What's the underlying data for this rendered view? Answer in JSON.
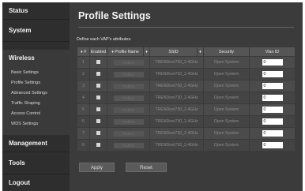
{
  "sidebar": {
    "items": [
      {
        "label": "Status"
      },
      {
        "label": "System"
      },
      {
        "label": "Wireless"
      },
      {
        "label": "Management"
      },
      {
        "label": "Tools"
      },
      {
        "label": "Logout"
      }
    ],
    "wireless_subitems": [
      {
        "label": "Basic Settings"
      },
      {
        "label": "Profile Settings"
      },
      {
        "label": "Advanced Settings"
      },
      {
        "label": "Traffic Shaping"
      },
      {
        "label": "Access Control"
      },
      {
        "label": "WDS Settings"
      }
    ]
  },
  "main": {
    "title": "Profile Settings",
    "description": "Define each VAP's attributes.",
    "table": {
      "headers": [
        "♦ #",
        "Enabled",
        "♦ Profile Name",
        "♦",
        "SSID",
        "♦",
        "Security",
        "Vlan ID"
      ],
      "rows": [
        {
          "num": "1",
          "profile": "Profile1",
          "ssid": "TRENDnet730_2.4GHz",
          "security": "Open System",
          "vlan": "0"
        },
        {
          "num": "2",
          "profile": "Profile2",
          "ssid": "TRENDnet730_2.4GHz",
          "security": "Open System",
          "vlan": "0"
        },
        {
          "num": "3",
          "profile": "Profile3",
          "ssid": "TRENDnet730_2.4GHz",
          "security": "Open System",
          "vlan": "0"
        },
        {
          "num": "4",
          "profile": "Profile4",
          "ssid": "TRENDnet730_2.4GHz",
          "security": "Open System",
          "vlan": "0"
        },
        {
          "num": "5",
          "profile": "Profile5",
          "ssid": "TRENDnet730_2.4GHz",
          "security": "Open System",
          "vlan": "0"
        },
        {
          "num": "6",
          "profile": "Profile6",
          "ssid": "TRENDnet730_2.4GHz",
          "security": "Open System",
          "vlan": "0"
        },
        {
          "num": "7",
          "profile": "Profile7",
          "ssid": "TRENDnet730_2.4GHz",
          "security": "Open System",
          "vlan": "0"
        },
        {
          "num": "8",
          "profile": "Profile8",
          "ssid": "TRENDnet730_2.4GHz",
          "security": "Open System",
          "vlan": "0"
        }
      ]
    },
    "buttons": {
      "apply": "Apply",
      "reset": "Reset"
    }
  }
}
